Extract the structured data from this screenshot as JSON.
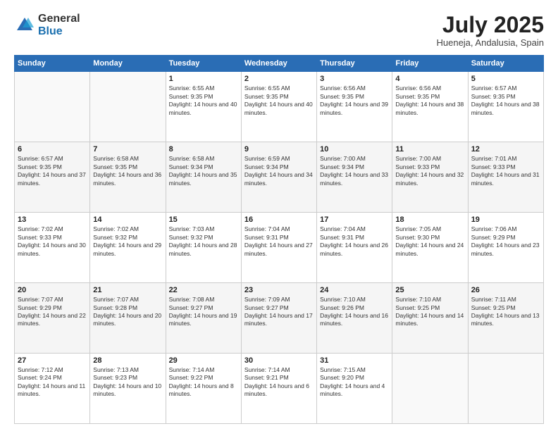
{
  "logo": {
    "general": "General",
    "blue": "Blue"
  },
  "header": {
    "month_year": "July 2025",
    "location": "Hueneja, Andalusia, Spain"
  },
  "weekdays": [
    "Sunday",
    "Monday",
    "Tuesday",
    "Wednesday",
    "Thursday",
    "Friday",
    "Saturday"
  ],
  "weeks": [
    [
      {
        "day": "",
        "sunrise": "",
        "sunset": "",
        "daylight": ""
      },
      {
        "day": "",
        "sunrise": "",
        "sunset": "",
        "daylight": ""
      },
      {
        "day": "1",
        "sunrise": "Sunrise: 6:55 AM",
        "sunset": "Sunset: 9:35 PM",
        "daylight": "Daylight: 14 hours and 40 minutes."
      },
      {
        "day": "2",
        "sunrise": "Sunrise: 6:55 AM",
        "sunset": "Sunset: 9:35 PM",
        "daylight": "Daylight: 14 hours and 40 minutes."
      },
      {
        "day": "3",
        "sunrise": "Sunrise: 6:56 AM",
        "sunset": "Sunset: 9:35 PM",
        "daylight": "Daylight: 14 hours and 39 minutes."
      },
      {
        "day": "4",
        "sunrise": "Sunrise: 6:56 AM",
        "sunset": "Sunset: 9:35 PM",
        "daylight": "Daylight: 14 hours and 38 minutes."
      },
      {
        "day": "5",
        "sunrise": "Sunrise: 6:57 AM",
        "sunset": "Sunset: 9:35 PM",
        "daylight": "Daylight: 14 hours and 38 minutes."
      }
    ],
    [
      {
        "day": "6",
        "sunrise": "Sunrise: 6:57 AM",
        "sunset": "Sunset: 9:35 PM",
        "daylight": "Daylight: 14 hours and 37 minutes."
      },
      {
        "day": "7",
        "sunrise": "Sunrise: 6:58 AM",
        "sunset": "Sunset: 9:35 PM",
        "daylight": "Daylight: 14 hours and 36 minutes."
      },
      {
        "day": "8",
        "sunrise": "Sunrise: 6:58 AM",
        "sunset": "Sunset: 9:34 PM",
        "daylight": "Daylight: 14 hours and 35 minutes."
      },
      {
        "day": "9",
        "sunrise": "Sunrise: 6:59 AM",
        "sunset": "Sunset: 9:34 PM",
        "daylight": "Daylight: 14 hours and 34 minutes."
      },
      {
        "day": "10",
        "sunrise": "Sunrise: 7:00 AM",
        "sunset": "Sunset: 9:34 PM",
        "daylight": "Daylight: 14 hours and 33 minutes."
      },
      {
        "day": "11",
        "sunrise": "Sunrise: 7:00 AM",
        "sunset": "Sunset: 9:33 PM",
        "daylight": "Daylight: 14 hours and 32 minutes."
      },
      {
        "day": "12",
        "sunrise": "Sunrise: 7:01 AM",
        "sunset": "Sunset: 9:33 PM",
        "daylight": "Daylight: 14 hours and 31 minutes."
      }
    ],
    [
      {
        "day": "13",
        "sunrise": "Sunrise: 7:02 AM",
        "sunset": "Sunset: 9:33 PM",
        "daylight": "Daylight: 14 hours and 30 minutes."
      },
      {
        "day": "14",
        "sunrise": "Sunrise: 7:02 AM",
        "sunset": "Sunset: 9:32 PM",
        "daylight": "Daylight: 14 hours and 29 minutes."
      },
      {
        "day": "15",
        "sunrise": "Sunrise: 7:03 AM",
        "sunset": "Sunset: 9:32 PM",
        "daylight": "Daylight: 14 hours and 28 minutes."
      },
      {
        "day": "16",
        "sunrise": "Sunrise: 7:04 AM",
        "sunset": "Sunset: 9:31 PM",
        "daylight": "Daylight: 14 hours and 27 minutes."
      },
      {
        "day": "17",
        "sunrise": "Sunrise: 7:04 AM",
        "sunset": "Sunset: 9:31 PM",
        "daylight": "Daylight: 14 hours and 26 minutes."
      },
      {
        "day": "18",
        "sunrise": "Sunrise: 7:05 AM",
        "sunset": "Sunset: 9:30 PM",
        "daylight": "Daylight: 14 hours and 24 minutes."
      },
      {
        "day": "19",
        "sunrise": "Sunrise: 7:06 AM",
        "sunset": "Sunset: 9:29 PM",
        "daylight": "Daylight: 14 hours and 23 minutes."
      }
    ],
    [
      {
        "day": "20",
        "sunrise": "Sunrise: 7:07 AM",
        "sunset": "Sunset: 9:29 PM",
        "daylight": "Daylight: 14 hours and 22 minutes."
      },
      {
        "day": "21",
        "sunrise": "Sunrise: 7:07 AM",
        "sunset": "Sunset: 9:28 PM",
        "daylight": "Daylight: 14 hours and 20 minutes."
      },
      {
        "day": "22",
        "sunrise": "Sunrise: 7:08 AM",
        "sunset": "Sunset: 9:27 PM",
        "daylight": "Daylight: 14 hours and 19 minutes."
      },
      {
        "day": "23",
        "sunrise": "Sunrise: 7:09 AM",
        "sunset": "Sunset: 9:27 PM",
        "daylight": "Daylight: 14 hours and 17 minutes."
      },
      {
        "day": "24",
        "sunrise": "Sunrise: 7:10 AM",
        "sunset": "Sunset: 9:26 PM",
        "daylight": "Daylight: 14 hours and 16 minutes."
      },
      {
        "day": "25",
        "sunrise": "Sunrise: 7:10 AM",
        "sunset": "Sunset: 9:25 PM",
        "daylight": "Daylight: 14 hours and 14 minutes."
      },
      {
        "day": "26",
        "sunrise": "Sunrise: 7:11 AM",
        "sunset": "Sunset: 9:25 PM",
        "daylight": "Daylight: 14 hours and 13 minutes."
      }
    ],
    [
      {
        "day": "27",
        "sunrise": "Sunrise: 7:12 AM",
        "sunset": "Sunset: 9:24 PM",
        "daylight": "Daylight: 14 hours and 11 minutes."
      },
      {
        "day": "28",
        "sunrise": "Sunrise: 7:13 AM",
        "sunset": "Sunset: 9:23 PM",
        "daylight": "Daylight: 14 hours and 10 minutes."
      },
      {
        "day": "29",
        "sunrise": "Sunrise: 7:14 AM",
        "sunset": "Sunset: 9:22 PM",
        "daylight": "Daylight: 14 hours and 8 minutes."
      },
      {
        "day": "30",
        "sunrise": "Sunrise: 7:14 AM",
        "sunset": "Sunset: 9:21 PM",
        "daylight": "Daylight: 14 hours and 6 minutes."
      },
      {
        "day": "31",
        "sunrise": "Sunrise: 7:15 AM",
        "sunset": "Sunset: 9:20 PM",
        "daylight": "Daylight: 14 hours and 4 minutes."
      },
      {
        "day": "",
        "sunrise": "",
        "sunset": "",
        "daylight": ""
      },
      {
        "day": "",
        "sunrise": "",
        "sunset": "",
        "daylight": ""
      }
    ]
  ]
}
